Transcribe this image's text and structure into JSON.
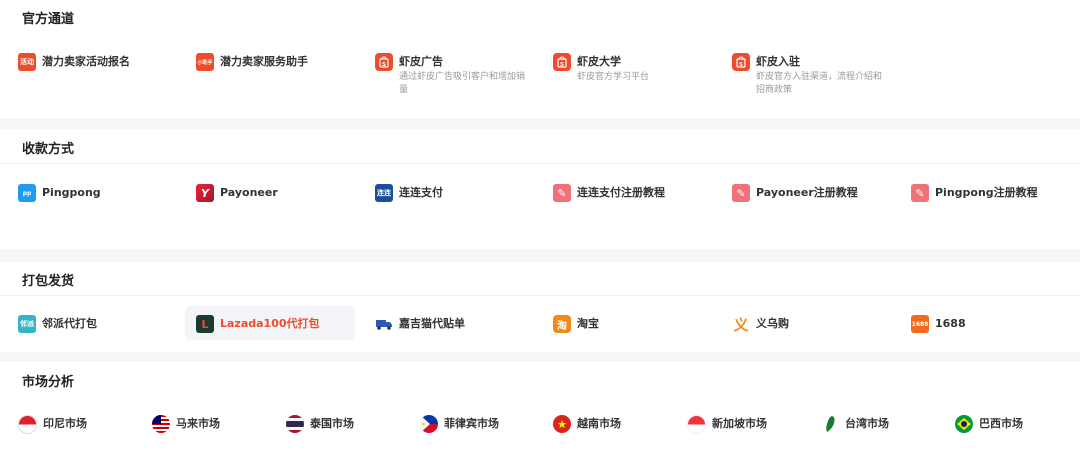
{
  "sections": {
    "official": {
      "title": "官方通道",
      "items": [
        {
          "label": "潜力卖家活动报名",
          "icon": "活动",
          "icon_name": "activity-badge-icon",
          "color": "#ee4d2d"
        },
        {
          "label": "潜力卖家服务助手",
          "icon": "小助手",
          "icon_name": "assistant-badge-icon",
          "color": "#ee4d2d"
        },
        {
          "label": "虾皮广告",
          "icon": "S",
          "icon_name": "shopee-bag-icon",
          "color": "#ee4d2d",
          "desc": "通过虾皮广告吸引客户和增加销量"
        },
        {
          "label": "虾皮大学",
          "icon": "S",
          "icon_name": "shopee-bag-icon",
          "color": "#ee4d2d",
          "desc": "虾皮官方学习平台"
        },
        {
          "label": "虾皮入驻",
          "icon": "S",
          "icon_name": "shopee-bag-icon",
          "color": "#ee4d2d",
          "desc": "虾皮官方入驻渠道，流程介绍和招商政策"
        }
      ]
    },
    "payment": {
      "title": "收款方式",
      "items": [
        {
          "label": "Pingpong",
          "icon": "pp",
          "icon_name": "pingpong-logo-icon",
          "color": "#1f9cf0"
        },
        {
          "label": "Payoneer",
          "icon": "Y",
          "icon_name": "payoneer-logo-icon",
          "color": "#e8243a"
        },
        {
          "label": "连连支付",
          "icon": "连连",
          "icon_name": "lianlian-logo-icon",
          "color": "#1b4f9c"
        },
        {
          "label": "连连支付注册教程",
          "icon": "✎",
          "icon_name": "pencil-icon",
          "color": "#f07178"
        },
        {
          "label": "Payoneer注册教程",
          "icon": "✎",
          "icon_name": "pencil-icon",
          "color": "#f07178"
        },
        {
          "label": "Pingpong注册教程",
          "icon": "✎",
          "icon_name": "pencil-icon",
          "color": "#f07178"
        }
      ]
    },
    "shipping": {
      "title": "打包发货",
      "items": [
        {
          "label": "邻派代打包",
          "icon": "邻派",
          "icon_name": "linpai-logo-icon",
          "color": "#35b6c8"
        },
        {
          "label": "Lazada100代打包",
          "icon": "L",
          "icon_name": "lazada-logo-icon",
          "color": "#1c3b2e",
          "highlight": true
        },
        {
          "label": "嘉吉猫代贴单",
          "icon": "🚚",
          "icon_name": "truck-icon",
          "color": "#ffffff"
        },
        {
          "label": "淘宝",
          "icon": "淘",
          "icon_name": "taobao-logo-icon",
          "color": "#f28a1b"
        },
        {
          "label": "义乌购",
          "icon": "义",
          "icon_name": "yiwugou-logo-icon",
          "color": "#ffffff"
        },
        {
          "label": "1688",
          "icon": "1688",
          "icon_name": "1688-logo-icon",
          "color": "#f26a1b"
        }
      ]
    },
    "market": {
      "title": "市场分析",
      "items": [
        {
          "label": "印尼市场",
          "icon_name": "indonesia-flag-icon",
          "flag": "id"
        },
        {
          "label": "马来市场",
          "icon_name": "malaysia-flag-icon",
          "flag": "my"
        },
        {
          "label": "泰国市场",
          "icon_name": "thailand-flag-icon",
          "flag": "th"
        },
        {
          "label": "菲律宾市场",
          "icon_name": "philippines-flag-icon",
          "flag": "ph"
        },
        {
          "label": "越南市场",
          "icon_name": "vietnam-flag-icon",
          "flag": "vn"
        },
        {
          "label": "新加坡市场",
          "icon_name": "singapore-flag-icon",
          "flag": "sg"
        },
        {
          "label": "台湾市场",
          "icon_name": "taiwan-map-icon",
          "flag": "tw"
        },
        {
          "label": "巴西市场",
          "icon_name": "brazil-flag-icon",
          "flag": "br"
        }
      ]
    }
  }
}
